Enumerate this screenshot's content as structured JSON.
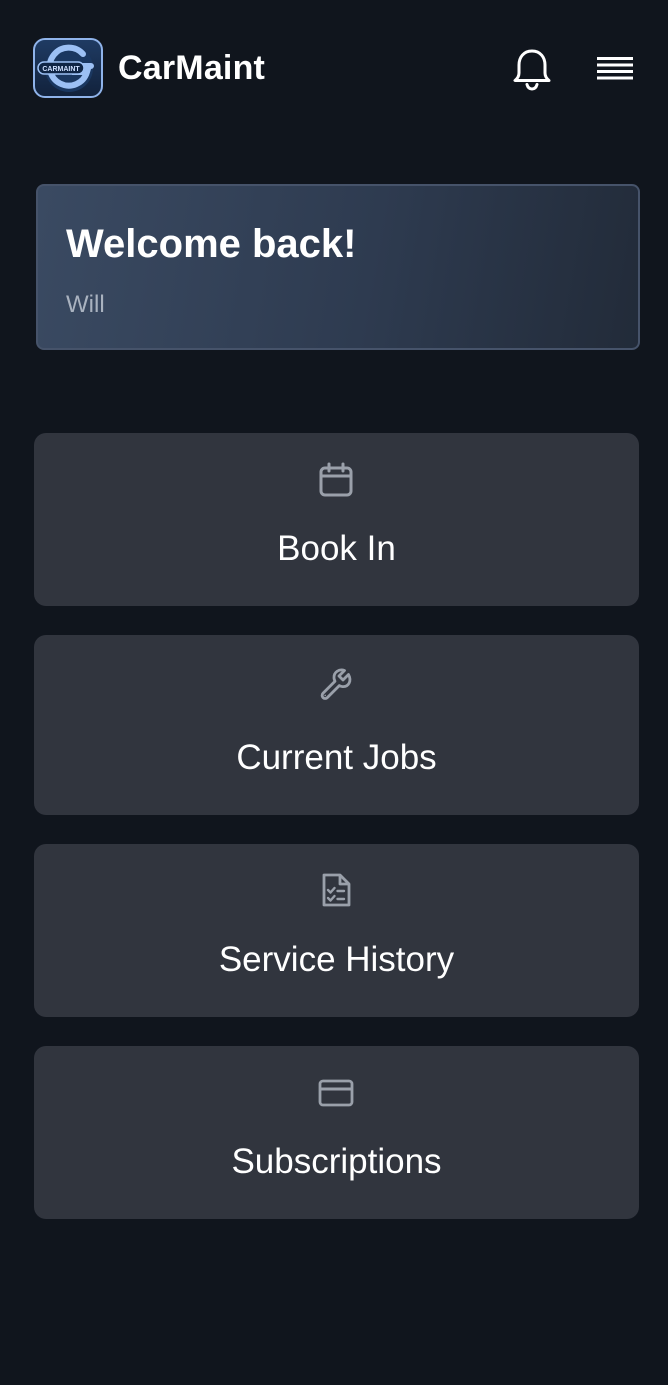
{
  "header": {
    "logo_text": "CARMAINT",
    "brand": "CarMaint",
    "notifications_icon": "bell-icon",
    "menu_icon": "menu-icon"
  },
  "welcome": {
    "title": "Welcome back!",
    "user": "Will"
  },
  "actions": [
    {
      "label": "Book In",
      "icon": "calendar-icon"
    },
    {
      "label": "Current Jobs",
      "icon": "wrench-icon"
    },
    {
      "label": "Service History",
      "icon": "checklist-document-icon"
    },
    {
      "label": "Subscriptions",
      "icon": "credit-card-icon"
    }
  ],
  "colors": {
    "background": "#10151d",
    "card": "#31353e",
    "welcome_border": "#46536a",
    "text_primary": "#ffffff",
    "text_secondary": "#a9b2bf",
    "icon_muted": "#9aa0aa",
    "logo_accent": "#8fb3ea"
  }
}
